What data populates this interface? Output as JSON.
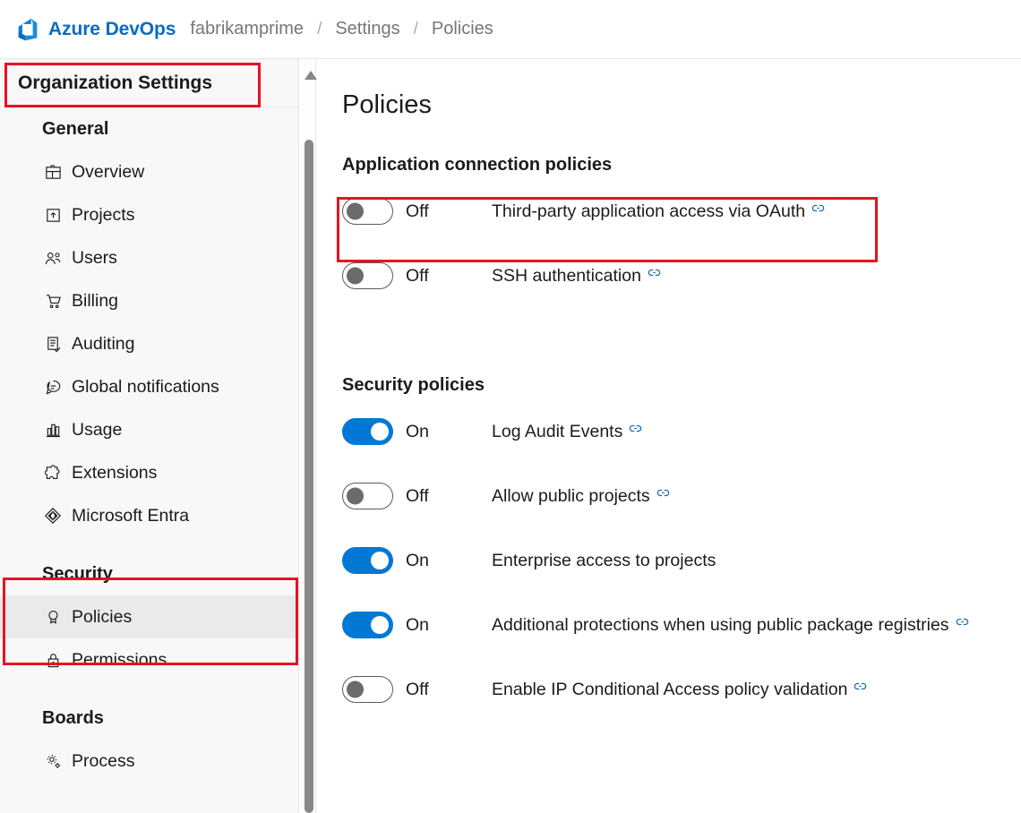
{
  "header": {
    "logo_icon": "azure-devops-logo",
    "brand": "Azure DevOps",
    "breadcrumb": [
      {
        "label": "fabrikamprime"
      },
      {
        "label": "Settings"
      },
      {
        "label": "Policies"
      }
    ],
    "separator": "/"
  },
  "sidebar": {
    "title": "Organization Settings",
    "groups": [
      {
        "header": "General",
        "items": [
          {
            "label": "Overview",
            "icon": "overview-icon",
            "selected": false
          },
          {
            "label": "Projects",
            "icon": "projects-icon",
            "selected": false
          },
          {
            "label": "Users",
            "icon": "users-icon",
            "selected": false
          },
          {
            "label": "Billing",
            "icon": "billing-icon",
            "selected": false
          },
          {
            "label": "Auditing",
            "icon": "auditing-icon",
            "selected": false
          },
          {
            "label": "Global notifications",
            "icon": "notifications-icon",
            "selected": false
          },
          {
            "label": "Usage",
            "icon": "usage-icon",
            "selected": false
          },
          {
            "label": "Extensions",
            "icon": "extensions-icon",
            "selected": false
          },
          {
            "label": "Microsoft Entra",
            "icon": "entra-icon",
            "selected": false
          }
        ]
      },
      {
        "header": "Security",
        "items": [
          {
            "label": "Policies",
            "icon": "policies-icon",
            "selected": true
          },
          {
            "label": "Permissions",
            "icon": "permissions-icon",
            "selected": false
          }
        ]
      },
      {
        "header": "Boards",
        "items": [
          {
            "label": "Process",
            "icon": "process-icon",
            "selected": false
          }
        ]
      }
    ]
  },
  "main": {
    "page_title": "Policies",
    "sections": [
      {
        "title": "Application connection policies",
        "policies": [
          {
            "state": "Off",
            "on": false,
            "label": "Third-party application access via OAuth",
            "has_link": true
          },
          {
            "state": "Off",
            "on": false,
            "label": "SSH authentication",
            "has_link": true
          }
        ]
      },
      {
        "title": "Security policies",
        "policies": [
          {
            "state": "On",
            "on": true,
            "label": "Log Audit Events",
            "has_link": true
          },
          {
            "state": "Off",
            "on": false,
            "label": "Allow public projects",
            "has_link": true
          },
          {
            "state": "On",
            "on": true,
            "label": "Enterprise access to projects",
            "has_link": false
          },
          {
            "state": "On",
            "on": true,
            "label": "Additional protections when using public package registries",
            "has_link": true
          },
          {
            "state": "Off",
            "on": false,
            "label": "Enable IP Conditional Access policy validation",
            "has_link": true
          }
        ]
      }
    ]
  },
  "scrollbar": {
    "up_arrow_icon": "scroll-up-arrow-icon"
  },
  "annotations": {
    "highlight_color": "#e81123",
    "boxes": [
      {
        "target": "organization-settings-title"
      },
      {
        "target": "security-section"
      },
      {
        "target": "third-party-oauth-row"
      }
    ]
  },
  "colors": {
    "brand_blue": "#0b6cbf",
    "toggle_on": "#0078d4",
    "link_icon": "#1a6fb5",
    "selected_row": "#eaeaea"
  }
}
